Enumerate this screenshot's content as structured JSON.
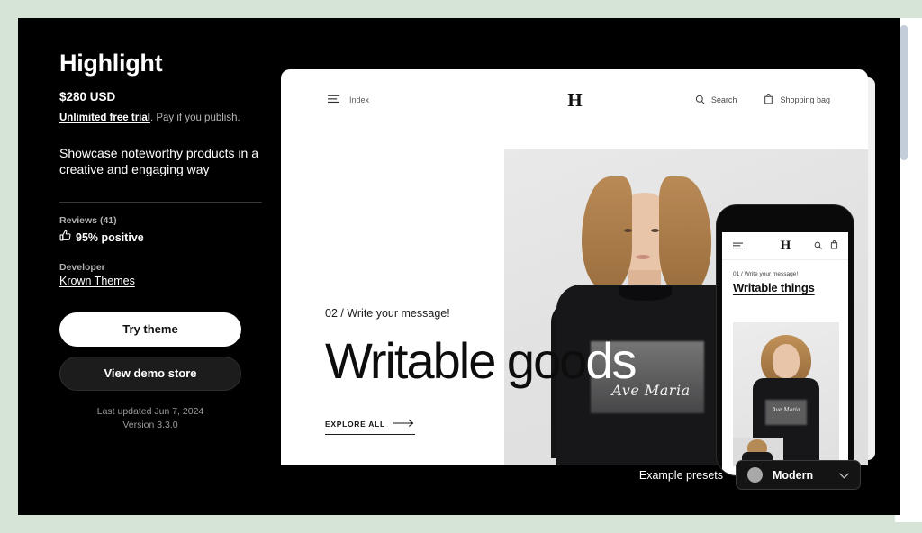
{
  "theme": {
    "title": "Highlight",
    "price": "$280 USD",
    "trial_link": "Unlimited free trial",
    "trial_rest": ". Pay if you publish.",
    "tagline": "Showcase noteworthy products in a creative and engaging way",
    "reviews_label": "Reviews (41)",
    "rating_text": "95% positive",
    "developer_label": "Developer",
    "developer_name": "Krown Themes",
    "try_button": "Try theme",
    "demo_button": "View demo store",
    "last_updated": "Last updated Jun 7, 2024",
    "version": "Version 3.3.0"
  },
  "desktop_preview": {
    "nav": {
      "index": "Index",
      "brand": "H",
      "search": "Search",
      "shopping_bag": "Shopping bag"
    },
    "hero": {
      "eyebrow": "02 / Write your message!",
      "title_dark": "Writable goo",
      "title_light": "ds",
      "cta": "EXPLORE ALL"
    },
    "product_print": "Ave Maria"
  },
  "phone_preview": {
    "brand": "H",
    "eyebrow": "01 / Write your message!",
    "title": "Writable things",
    "product_print": "Ave Maria"
  },
  "presets": {
    "label": "Example presets",
    "selected": "Modern",
    "swatch_color": "#a8a8a8"
  },
  "colors": {
    "page_background": "#d6e4d8",
    "card_background": "#000000",
    "accent_white": "#ffffff"
  }
}
